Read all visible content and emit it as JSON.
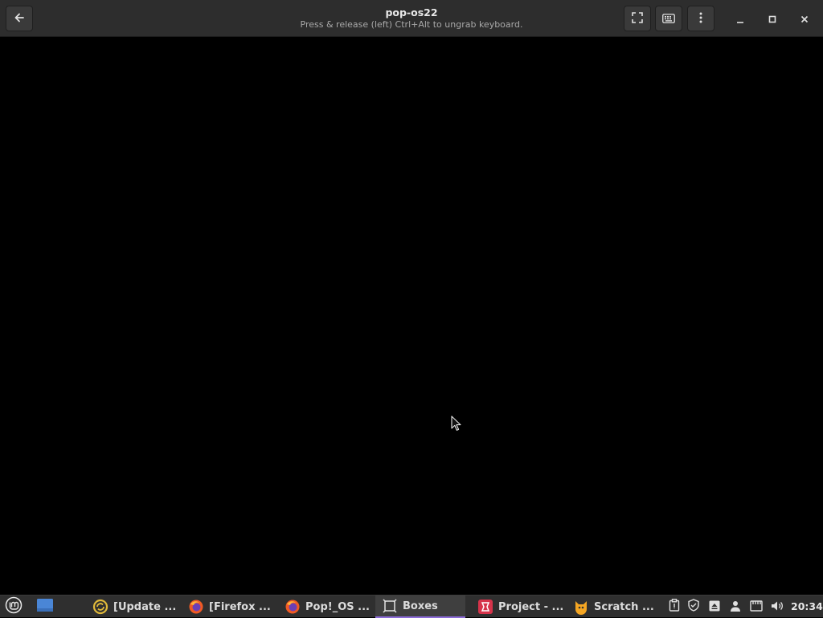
{
  "window": {
    "title": "pop-os22",
    "subtitle": "Press & release (left) Ctrl+Alt to ungrab keyboard."
  },
  "header": {
    "buttons": [
      {
        "name": "back",
        "icon": "back-arrow-icon"
      },
      {
        "name": "fullscreen",
        "icon": "fullscreen-icon"
      },
      {
        "name": "keyboard",
        "icon": "keyboard-icon"
      },
      {
        "name": "menu",
        "icon": "vertical-dots-icon"
      },
      {
        "name": "minimize",
        "icon": "minimize-icon"
      },
      {
        "name": "maximize",
        "icon": "maximize-icon"
      },
      {
        "name": "close",
        "icon": "close-icon"
      }
    ]
  },
  "taskbar": {
    "tasks": [
      {
        "label": "[Update ...",
        "icon": "update-manager-icon",
        "active": false
      },
      {
        "label": "[Firefox ...",
        "icon": "firefox-icon",
        "active": false
      },
      {
        "label": "Pop!_OS ...",
        "icon": "firefox-icon",
        "active": false
      },
      {
        "label": "Boxes",
        "icon": "boxes-icon",
        "active": true
      },
      {
        "label": "Project - ...",
        "icon": "project-icon",
        "active": false
      },
      {
        "label": "Scratch ...",
        "icon": "scratch-icon",
        "active": false
      }
    ],
    "tray": [
      "clipboard-icon",
      "shield-icon",
      "eject-icon",
      "user-icon",
      "network-icon",
      "volume-icon"
    ],
    "clock": "20:34",
    "accent": "#8c6bd8"
  }
}
